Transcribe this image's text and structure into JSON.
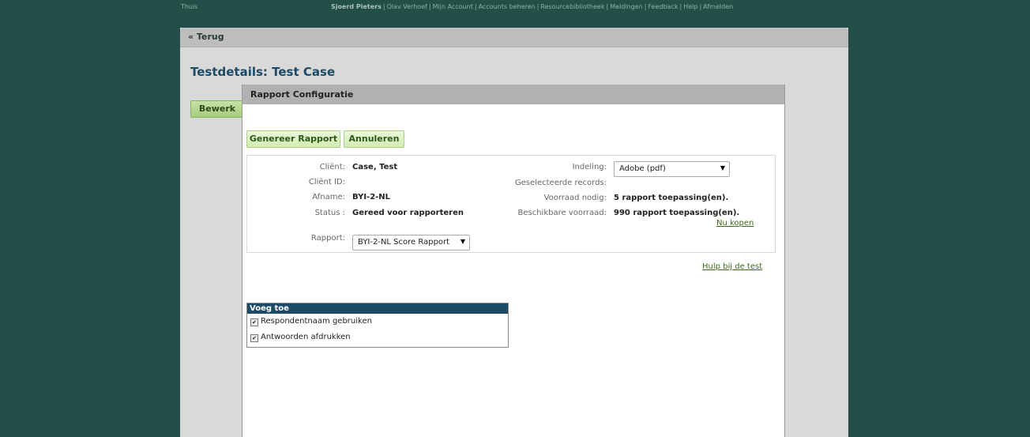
{
  "topnav": {
    "home": "Thuis",
    "user": "Sjoerd Pieters",
    "links": [
      "Olav Verhoef",
      "Mijn Account",
      "Accounts beheren",
      "Resourcebibliotheek",
      "Meldingen",
      "Feedback",
      "Help",
      "Afmelden"
    ]
  },
  "page": {
    "back_label": "« Terug",
    "title": "Testdetails: Test Case",
    "edit_label": "Bewerk"
  },
  "modal": {
    "title": "Rapport Configuratie",
    "generate_label": "Genereer Rapport",
    "cancel_label": "Annuleren",
    "client_label": "Cliënt:",
    "client_value": "Case, Test",
    "clientid_label": "Cliënt ID:",
    "clientid_value": "",
    "afname_label": "Afname:",
    "afname_value": "BYI-2-NL",
    "status_label": "Status :",
    "status_value": "Gereed voor rapporteren",
    "rapport_label": "Rapport:",
    "rapport_value": "BYI-2-NL Score Rapport",
    "indeling_label": "Indeling:",
    "indeling_value": "Adobe (pdf)",
    "records_label": "Geselecteerde records:",
    "records_value": "",
    "voorraad_label": "Voorraad nodig:",
    "voorraad_value": "5 rapport toepassing(en).",
    "beschikbaar_label": "Beschikbare voorraad:",
    "beschikbaar_value": "990 rapport toepassing(en).",
    "buy_link": "Nu kopen",
    "help_link": "Hulp bij de test",
    "voeg_title": "Voeg toe",
    "options": [
      {
        "label": "Respondentnaam gebruiken",
        "checked": true
      },
      {
        "label": "Antwoorden afdrukken",
        "checked": true
      }
    ]
  }
}
